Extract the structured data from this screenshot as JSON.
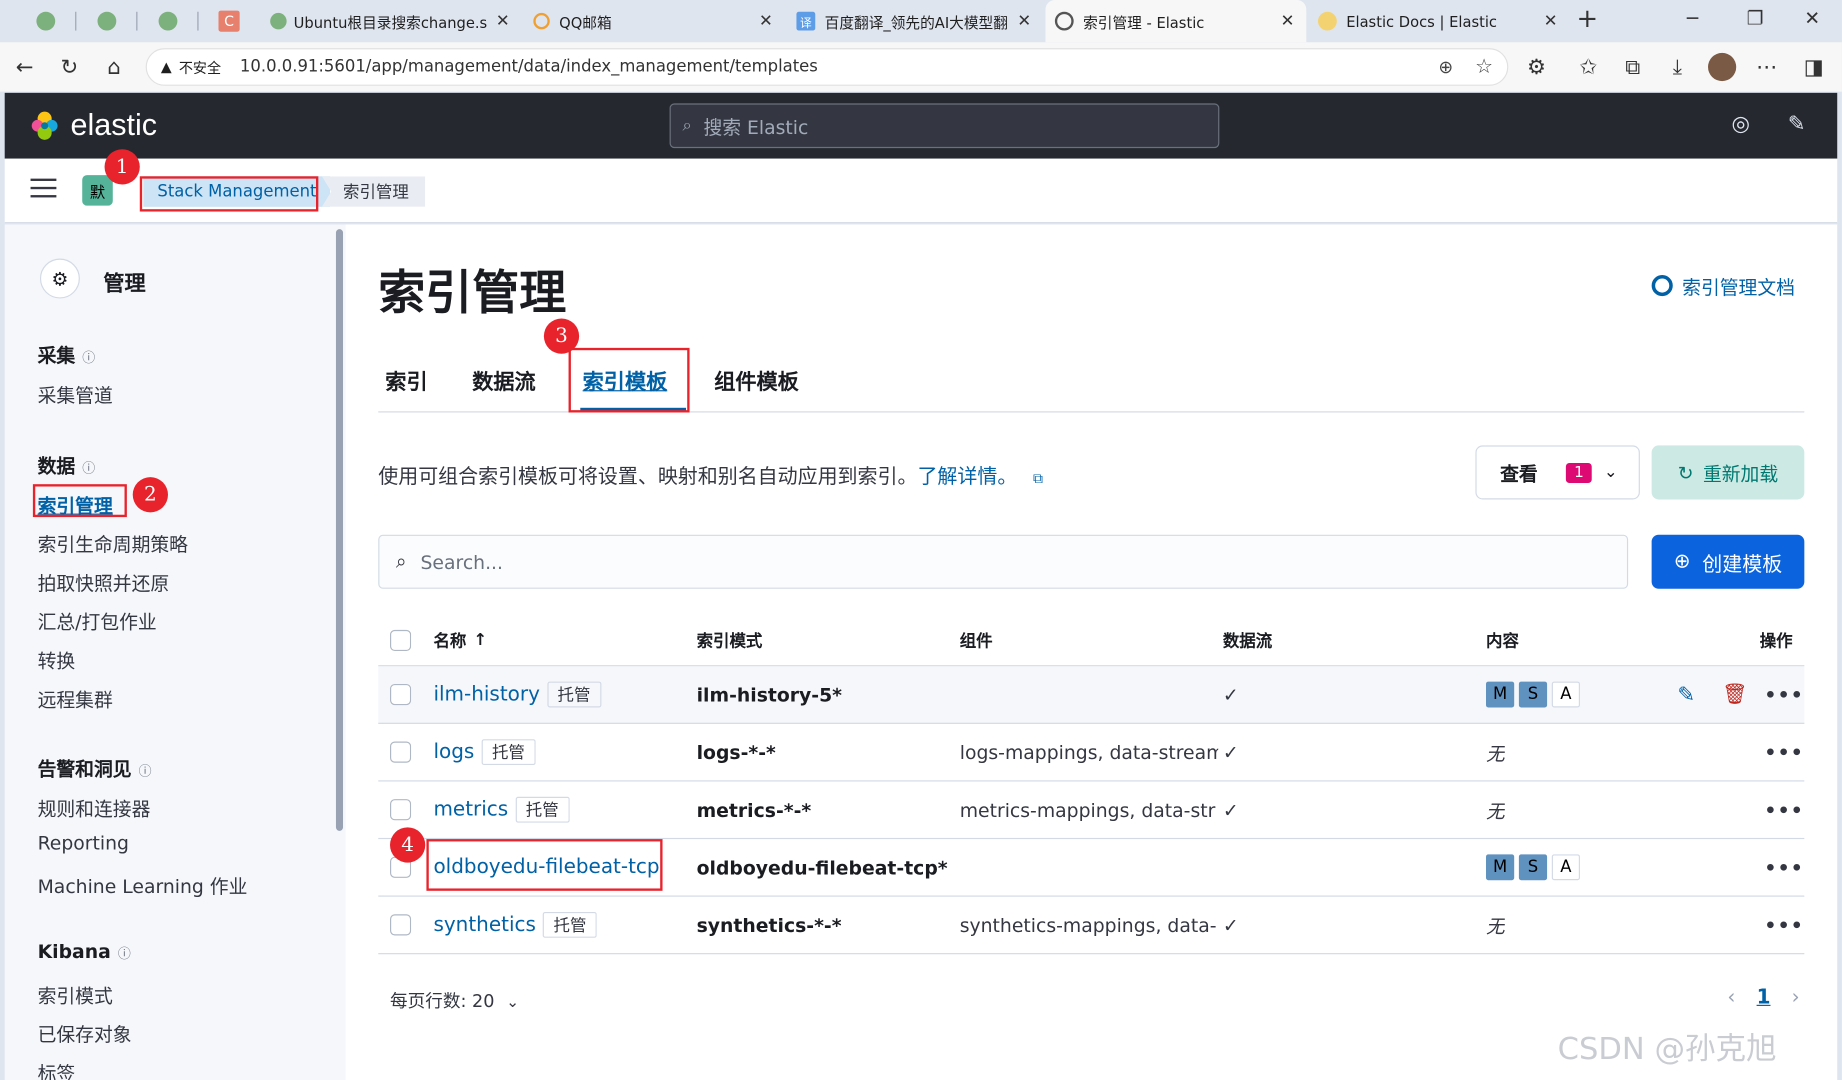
{
  "browser": {
    "tabs": [
      {
        "title": "Ubuntu根目录搜索change.s",
        "active": false
      },
      {
        "title": "QQ邮箱",
        "active": false
      },
      {
        "title": "百度翻译_领先的AI大模型翻",
        "active": false
      },
      {
        "title": "索引管理 - Elastic",
        "active": true
      },
      {
        "title": "Elastic Docs | Elastic",
        "active": false
      }
    ],
    "new_tab_glyph": "+",
    "pinned_letter": "C",
    "insecure_label": "不安全",
    "url": "10.0.0.91:5601/app/management/data/index_management/templates"
  },
  "kibana": {
    "logo_text": "elastic",
    "search_placeholder": "搜索 Elastic",
    "space_initial": "默",
    "breadcrumbs": [
      "Stack Management",
      "索引管理"
    ]
  },
  "sidebar": {
    "title": "管理",
    "sections": [
      {
        "title": "采集",
        "items": [
          "采集管道"
        ]
      },
      {
        "title": "数据",
        "items": [
          "索引管理",
          "索引生命周期策略",
          "拍取快照并还原",
          "汇总/打包作业",
          "转换",
          "远程集群"
        ]
      },
      {
        "title": "告警和洞见",
        "items": [
          "规则和连接器",
          "Reporting",
          "Machine Learning 作业"
        ]
      },
      {
        "title": "Kibana",
        "items": [
          "索引模式",
          "已保存对象",
          "标签"
        ]
      }
    ],
    "selected_item": "索引管理"
  },
  "main": {
    "title": "索引管理",
    "doc_link": "索引管理文档",
    "tabs": [
      "索引",
      "数据流",
      "索引模板",
      "组件模板"
    ],
    "active_tab": "索引模板",
    "description": "使用可组合索引模板可将设置、映射和别名自动应用到索引。",
    "learn_more": "了解详情。",
    "view_label": "查看",
    "view_count": "1",
    "reload_label": "重新加载",
    "search_placeholder": "Search...",
    "create_label": "创建模板",
    "table": {
      "headers": [
        "名称",
        "索引模式",
        "组件",
        "数据流",
        "内容",
        "操作"
      ],
      "rows": [
        {
          "name": "ilm-history",
          "badge": "托管",
          "pattern": "ilm-history-5*",
          "components": "",
          "data_stream": "✓",
          "content": [
            "M",
            "S",
            "A"
          ],
          "actions": [
            "edit",
            "delete",
            "more"
          ]
        },
        {
          "name": "logs",
          "badge": "托管",
          "pattern": "logs-*-*",
          "components": "logs-mappings, data-stream",
          "data_stream": "✓",
          "content_text": "无",
          "actions": [
            "more"
          ]
        },
        {
          "name": "metrics",
          "badge": "托管",
          "pattern": "metrics-*-*",
          "components": "metrics-mappings, data-str",
          "data_stream": "✓",
          "content_text": "无",
          "actions": [
            "more"
          ]
        },
        {
          "name": "oldboyedu-filebeat-tcp",
          "badge": "",
          "pattern": "oldboyedu-filebeat-tcp*",
          "components": "",
          "data_stream": "",
          "content": [
            "M",
            "S",
            "A"
          ],
          "actions": [
            "more"
          ]
        },
        {
          "name": "synthetics",
          "badge": "托管",
          "pattern": "synthetics-*-*",
          "components": "synthetics-mappings, data-",
          "data_stream": "✓",
          "content_text": "无",
          "actions": [
            "more"
          ]
        }
      ]
    },
    "rows_per_page": "每页行数: 20",
    "current_page": "1"
  },
  "annotations": [
    "1",
    "2",
    "3",
    "4"
  ],
  "watermark": "CSDN @孙克旭",
  "colors": {
    "accent": "#0061a6",
    "header_bg": "#25282f",
    "annotation": "#e8232c",
    "primary_button": "#0b64dd"
  }
}
